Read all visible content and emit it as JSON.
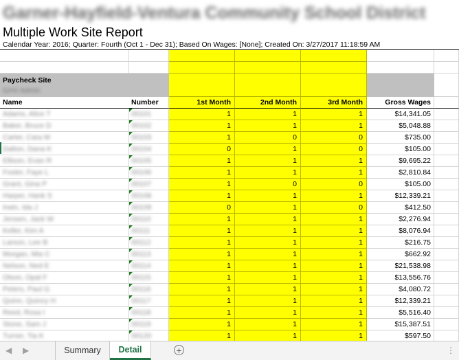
{
  "report": {
    "district_name": "Garner-Hayfield-Ventura Community School District",
    "title": "Multiple Work Site Report",
    "subtitle": "Calendar Year: 2016; Quarter: Fourth (Oct 1 - Dec 31); Based On Wages: [None]; Created On: 3/27/2017 11:18:59 AM"
  },
  "paycheck_site": {
    "label": "Paycheck Site",
    "value": "GHV Admin"
  },
  "columns": {
    "name": "Name",
    "number": "Number",
    "month1": "1st Month",
    "month2": "2nd Month",
    "month3": "3rd Month",
    "gross_wages": "Gross Wages"
  },
  "rows": [
    {
      "name": "Adams, Alice T",
      "number": "00101",
      "m1": "1",
      "m2": "1",
      "m3": "1",
      "wages": "$14,341.05"
    },
    {
      "name": "Baker, Bruce D",
      "number": "00102",
      "m1": "1",
      "m2": "1",
      "m3": "1",
      "wages": "$5,048.88"
    },
    {
      "name": "Carter, Cara M",
      "number": "00103",
      "m1": "1",
      "m2": "0",
      "m3": "0",
      "wages": "$735.00"
    },
    {
      "name": "Dalton, Dana K",
      "number": "00104",
      "m1": "0",
      "m2": "1",
      "m3": "0",
      "wages": "$105.00"
    },
    {
      "name": "Ellison, Evan R",
      "number": "00105",
      "m1": "1",
      "m2": "1",
      "m3": "1",
      "wages": "$9,695.22"
    },
    {
      "name": "Foster, Faye L",
      "number": "00106",
      "m1": "1",
      "m2": "1",
      "m3": "1",
      "wages": "$2,810.84"
    },
    {
      "name": "Grant, Gina P",
      "number": "00107",
      "m1": "1",
      "m2": "0",
      "m3": "0",
      "wages": "$105.00"
    },
    {
      "name": "Harper, Hank S",
      "number": "00108",
      "m1": "1",
      "m2": "1",
      "m3": "1",
      "wages": "$12,339.21"
    },
    {
      "name": "Irwin, Ida J",
      "number": "00109",
      "m1": "0",
      "m2": "1",
      "m3": "0",
      "wages": "$412.50"
    },
    {
      "name": "Jensen, Jack W",
      "number": "00110",
      "m1": "1",
      "m2": "1",
      "m3": "1",
      "wages": "$2,276.94"
    },
    {
      "name": "Keller, Kim A",
      "number": "00111",
      "m1": "1",
      "m2": "1",
      "m3": "1",
      "wages": "$8,076.94"
    },
    {
      "name": "Larson, Lee B",
      "number": "00112",
      "m1": "1",
      "m2": "1",
      "m3": "1",
      "wages": "$216.75"
    },
    {
      "name": "Morgan, Mia C",
      "number": "00113",
      "m1": "1",
      "m2": "1",
      "m3": "1",
      "wages": "$662.92"
    },
    {
      "name": "Nelson, Ned E",
      "number": "00114",
      "m1": "1",
      "m2": "1",
      "m3": "1",
      "wages": "$21,538.98"
    },
    {
      "name": "Olson, Opal F",
      "number": "00115",
      "m1": "1",
      "m2": "1",
      "m3": "1",
      "wages": "$13,556.76"
    },
    {
      "name": "Peters, Paul G",
      "number": "00116",
      "m1": "1",
      "m2": "1",
      "m3": "1",
      "wages": "$4,080.72"
    },
    {
      "name": "Quinn, Quincy H",
      "number": "00117",
      "m1": "1",
      "m2": "1",
      "m3": "1",
      "wages": "$12,339.21"
    },
    {
      "name": "Reed, Rosa I",
      "number": "00118",
      "m1": "1",
      "m2": "1",
      "m3": "1",
      "wages": "$5,516.40"
    },
    {
      "name": "Stone, Sam J",
      "number": "00119",
      "m1": "1",
      "m2": "1",
      "m3": "1",
      "wages": "$15,387.51"
    },
    {
      "name": "Turner, Tia K",
      "number": "00120",
      "m1": "1",
      "m2": "1",
      "m3": "1",
      "wages": "$597.50"
    }
  ],
  "tabs": {
    "summary": "Summary",
    "detail": "Detail",
    "add_symbol": "+",
    "more_symbol": "⋮",
    "prev_symbol": "◀",
    "next_symbol": "▶",
    "active": "Detail"
  },
  "colors": {
    "month_highlight": "#ffff00",
    "header_gray": "#c0c0c0",
    "excel_green": "#217346"
  }
}
